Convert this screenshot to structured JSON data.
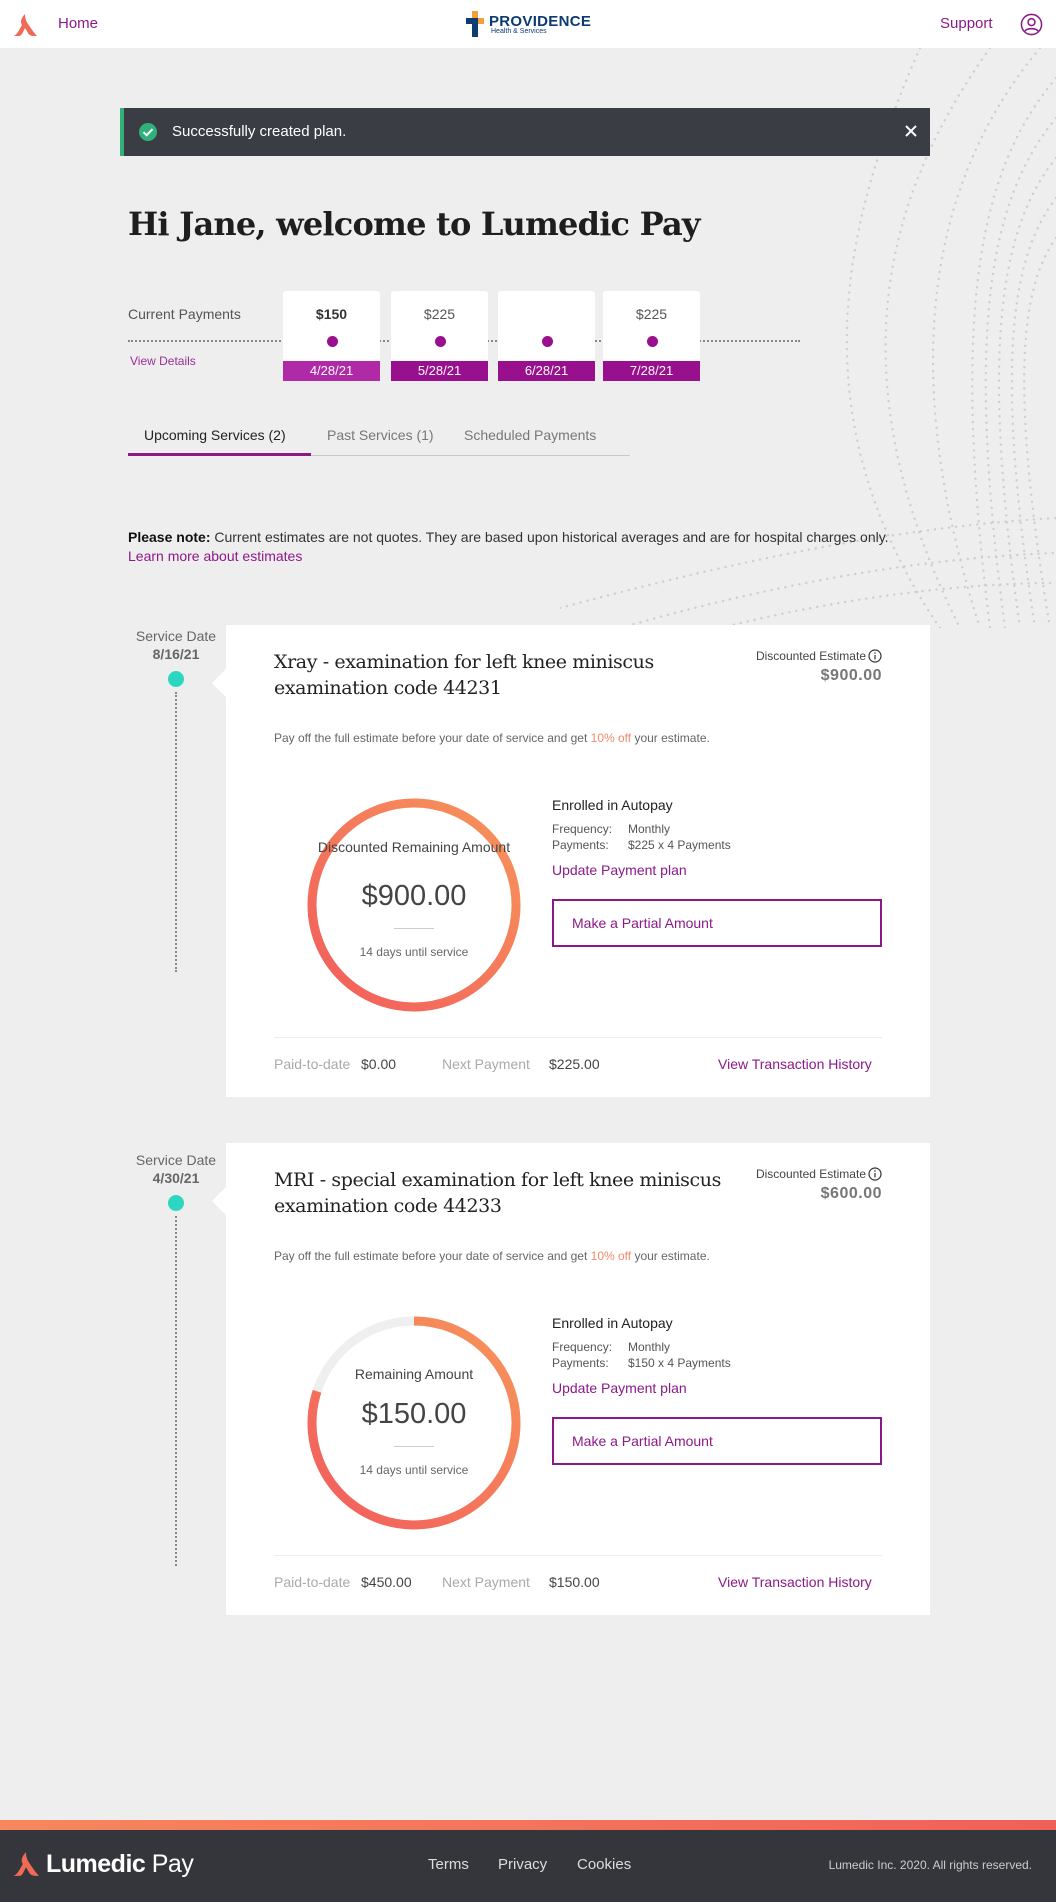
{
  "header": {
    "home_label": "Home",
    "brand_name": "PROVIDENCE",
    "brand_tagline": "Health & Services",
    "support_label": "Support"
  },
  "toast": {
    "message": "Successfully created plan."
  },
  "welcome": "Hi Jane, welcome to Lumedic Pay",
  "current_payments": {
    "label": "Current Payments",
    "details_link": "View Details",
    "items": [
      {
        "amount": "$150",
        "date": "4/28/21"
      },
      {
        "amount": "$225",
        "date": "5/28/21"
      },
      {
        "amount": "",
        "date": "6/28/21"
      },
      {
        "amount": "$225",
        "date": "7/28/21"
      }
    ]
  },
  "tabs": [
    {
      "label": "Upcoming Services (2)"
    },
    {
      "label": "Past Services (1)"
    },
    {
      "label": "Scheduled Payments"
    }
  ],
  "note": {
    "bold": "Please note:",
    "text": " Current estimates are not quotes. They are based upon historical averages and are for hospital charges only.",
    "link": "Learn more about estimates"
  },
  "services": [
    {
      "service_label": "Service Date",
      "service_date": "8/16/21",
      "title": "Xray - examination for left knee miniscus examination code 44231",
      "estimate_label": "Discounted Estimate",
      "estimate_value": "$900.00",
      "promo_before": "Pay off the full estimate before your date of service and get ",
      "promo_highlight": "10% off",
      "promo_after": " your estimate.",
      "ring_label": "Discounted Remaining Amount",
      "ring_amount": "$900.00",
      "ring_days": "14 days until service",
      "progress_fraction": 1.0,
      "autopay_title": "Enrolled in Autopay",
      "frequency_key": "Frequency:",
      "frequency_value": "Monthly",
      "payments_key": "Payments:",
      "payments_value": "$225 x 4 Payments",
      "update_link": "Update Payment plan",
      "partial_button": "Make a Partial Amount",
      "paid_key": "Paid-to-date",
      "paid_value": "$0.00",
      "next_key": "Next Payment",
      "next_value": "$225.00",
      "history_link": "View Transaction History"
    },
    {
      "service_label": "Service Date",
      "service_date": "4/30/21",
      "title": "MRI - special examination for left knee miniscus examination code 44233",
      "estimate_label": "Discounted Estimate",
      "estimate_value": "$600.00",
      "promo_before": "Pay off the full estimate before your date of service and get ",
      "promo_highlight": "10% off",
      "promo_after": " your estimate.",
      "ring_label": "Remaining Amount",
      "ring_amount": "$150.00",
      "ring_days": "14 days until service",
      "progress_fraction": 0.8,
      "autopay_title": "Enrolled in Autopay",
      "frequency_key": "Frequency:",
      "frequency_value": "Monthly",
      "payments_key": "Payments:",
      "payments_value": "$150 x 4 Payments",
      "update_link": "Update Payment plan",
      "partial_button": "Make a Partial Amount",
      "paid_key": "Paid-to-date",
      "paid_value": "$450.00",
      "next_key": "Next Payment",
      "next_value": "$150.00",
      "history_link": "View Transaction History"
    }
  ],
  "footer": {
    "brand_bold": "Lumedic",
    "brand_light": " Pay",
    "links": [
      "Terms",
      "Privacy",
      "Cookies"
    ],
    "copyright": "Lumedic Inc. 2020. All rights reserved."
  },
  "colors": {
    "accent": "#8b1a89",
    "toast_bg": "#3a3d43",
    "success": "#31b07a",
    "timeline_dot": "#2dd6c1",
    "ring_start": "#f25c5c",
    "ring_end": "#f7955a"
  },
  "icons": {
    "logo": "lumedic-logo-icon",
    "user": "user-circle-icon",
    "check": "check-circle-icon",
    "close": "close-icon",
    "info": "info-icon"
  }
}
